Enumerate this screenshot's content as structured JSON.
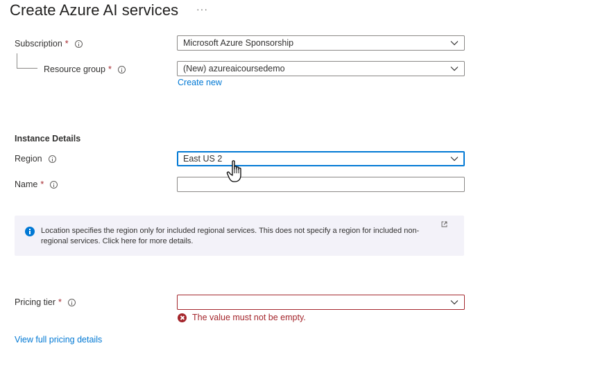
{
  "header": {
    "title": "Create Azure AI services",
    "more_label": "···"
  },
  "project_details": {
    "subscription": {
      "label": "Subscription",
      "required_mark": "*",
      "value": "Microsoft Azure Sponsorship"
    },
    "resource_group": {
      "label": "Resource group",
      "required_mark": "*",
      "value": "(New) azureaicoursedemo",
      "create_new_label": "Create new"
    }
  },
  "instance_details": {
    "heading": "Instance Details",
    "region": {
      "label": "Region",
      "value": "East US 2"
    },
    "name": {
      "label": "Name",
      "required_mark": "*",
      "value": ""
    },
    "info_message": "Location specifies the region only for included regional services. This does not specify a region for included non-regional services. Click here for more details."
  },
  "pricing": {
    "label": "Pricing tier",
    "required_mark": "*",
    "value": "",
    "error_message": "The value must not be empty.",
    "view_details_label": "View full pricing details"
  },
  "colors": {
    "link": "#0078d4",
    "error": "#a4262c",
    "focus": "#0078d4",
    "info_bg": "#f3f2f9"
  },
  "icons": [
    "info-icon",
    "chevron-down-icon",
    "error-icon",
    "external-link-icon",
    "hand-cursor-icon"
  ]
}
